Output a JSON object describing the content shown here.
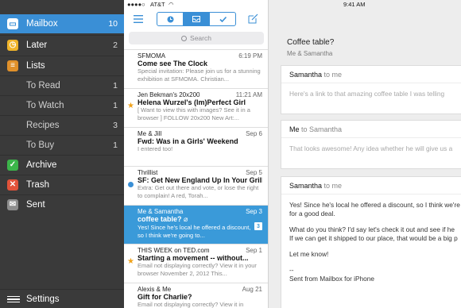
{
  "sidebar": {
    "items": [
      {
        "label": "Mailbox",
        "count": "10"
      },
      {
        "label": "Later",
        "count": "2"
      },
      {
        "label": "Lists",
        "count": ""
      },
      {
        "label": "To Read",
        "count": "1"
      },
      {
        "label": "To Watch",
        "count": "1"
      },
      {
        "label": "Recipes",
        "count": "3"
      },
      {
        "label": "To Buy",
        "count": "1"
      },
      {
        "label": "Archive",
        "count": ""
      },
      {
        "label": "Trash",
        "count": ""
      },
      {
        "label": "Sent",
        "count": ""
      },
      {
        "label": "Settings",
        "count": ""
      }
    ],
    "colors": {
      "mailbox": "#3a8fd6",
      "later": "#f0b42a",
      "lists": "#e0902a",
      "archive": "#3cb54a",
      "trash": "#e2533a",
      "sent": "#8e8e8e"
    }
  },
  "status": {
    "carrier": "AT&T",
    "time": "9:41 AM"
  },
  "search": {
    "placeholder": "Search"
  },
  "messages": [
    {
      "from": "SFMOMA",
      "time": "6:19 PM",
      "subject": "Come see The Clock",
      "snippet": "Special invitation: Please join us for a stunning exhibition at SFMOMA. Christian..."
    },
    {
      "from": "Jen Bekman's 20x200",
      "time": "11:21 AM",
      "subject": "Helena Wurzel's (Im)Perfect Girl",
      "snippet": "[ Want to view this with images? See it in a browser ] FOLLOW 20x200 New Art:..."
    },
    {
      "from": "Me & Jill",
      "time": "Sep 6",
      "subject": "Fwd: Was in a Girls' Weekend",
      "snippet": "I entered too!"
    },
    {
      "from": "Thrillist",
      "time": "Sep 5",
      "subject": "SF: Get New England Up In Your Grill",
      "snippet": "Extra: Get out there and vote, or lose the right to complain! A red, Torah..."
    },
    {
      "from": "Me & Samantha",
      "time": "Sep 3",
      "subject": "coffee table?",
      "snippet": "Yes! Since he's local he offered a discount, so I think we're going to...",
      "badge": "3"
    },
    {
      "from": "THIS WEEK on TED.com",
      "time": "Sep 1",
      "subject": "Starting a movement -- without...",
      "snippet": "Email not displaying correctly? View it in your browser November 2, 2012 This..."
    },
    {
      "from": "Alexis & Me",
      "time": "Aug 21",
      "subject": "Gift for Charlie?",
      "snippet": "Email not displaying correctly? View it in"
    }
  ],
  "thread": {
    "subject": "Coffee table?",
    "participants": "Me & Samantha",
    "cards": [
      {
        "from": "Samantha",
        "to": "to me",
        "body": "Here's a link to that amazing coffee table I was telling"
      },
      {
        "from": "Me",
        "to": "to Samantha",
        "body": "That looks awesome! Any idea whether he will give us a"
      },
      {
        "from": "Samantha",
        "to": "to me",
        "lines": [
          "Yes! Since he's local he offered a discount, so I think we're",
          "for a good deal.",
          "What do you think? I'd say let's check it out and see if he",
          "If we can get it shipped to our place, that would be a big p",
          "Let me know!",
          "--",
          "Sent from Mailbox for iPhone"
        ]
      }
    ]
  }
}
